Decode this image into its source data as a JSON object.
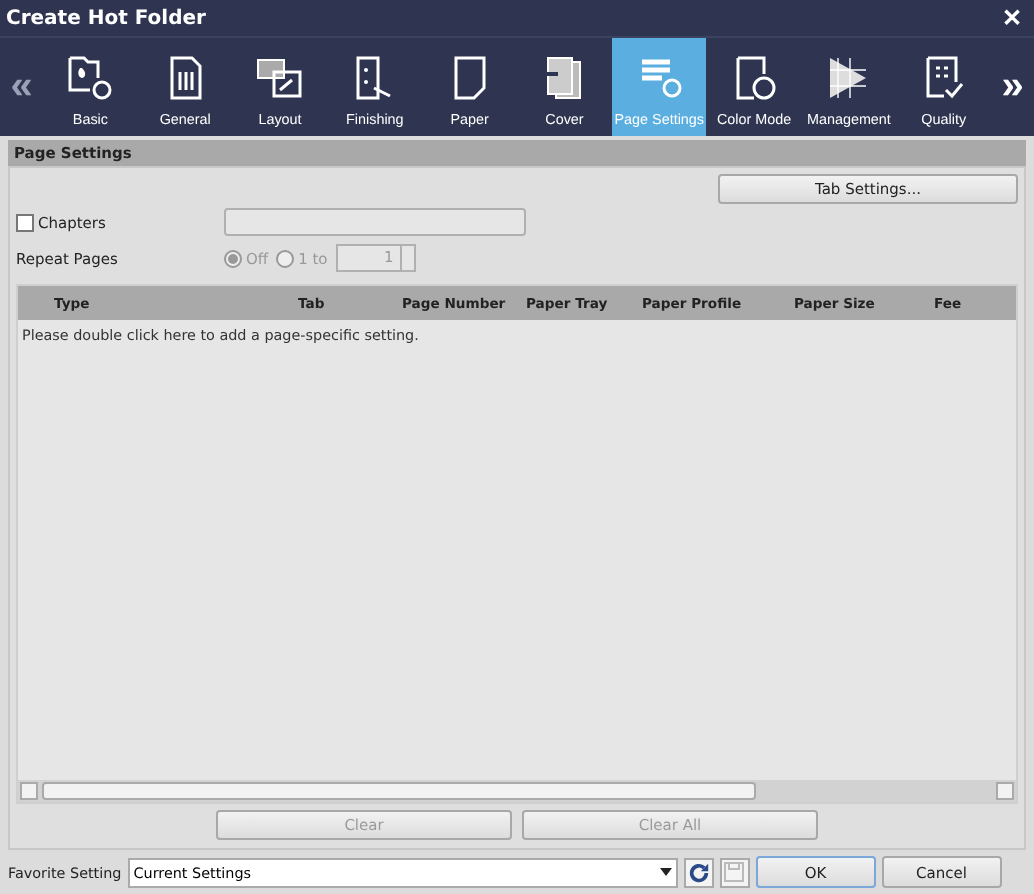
{
  "window": {
    "title": "Create Hot Folder",
    "close": "✕"
  },
  "toolbar": {
    "prev": "«",
    "next": "»",
    "items": [
      {
        "label": "Basic",
        "selected": false
      },
      {
        "label": "General",
        "selected": false
      },
      {
        "label": "Layout",
        "selected": false
      },
      {
        "label": "Finishing",
        "selected": false
      },
      {
        "label": "Paper",
        "selected": false
      },
      {
        "label": "Cover",
        "selected": false
      },
      {
        "label": "Page Settings",
        "selected": true
      },
      {
        "label": "Color Mode",
        "selected": false
      },
      {
        "label": "Management",
        "selected": false
      },
      {
        "label": "Quality",
        "selected": false
      }
    ]
  },
  "section": {
    "title": "Page Settings"
  },
  "tab_settings_button": "Tab Settings...",
  "chapters": {
    "label": "Chapters",
    "checked": false
  },
  "repeat_pages": {
    "label": "Repeat Pages",
    "disabled": true,
    "options": [
      {
        "label": "Off",
        "selected": true
      },
      {
        "label": "1 to",
        "selected": false
      }
    ],
    "value": "1"
  },
  "table": {
    "columns": [
      "Type",
      "Tab",
      "Page Number",
      "Paper Tray",
      "Paper Profile",
      "Paper Size",
      "Fee"
    ],
    "hint": "Please double click here to add a page-specific setting."
  },
  "buttons": [
    {
      "label": "Clear",
      "disabled": true
    },
    {
      "label": "Clear All",
      "disabled": true
    }
  ],
  "footer": {
    "label": "Favorite Setting",
    "value": "Current Settings",
    "save_disabled": true,
    "ok": "OK",
    "cancel": "Cancel"
  }
}
